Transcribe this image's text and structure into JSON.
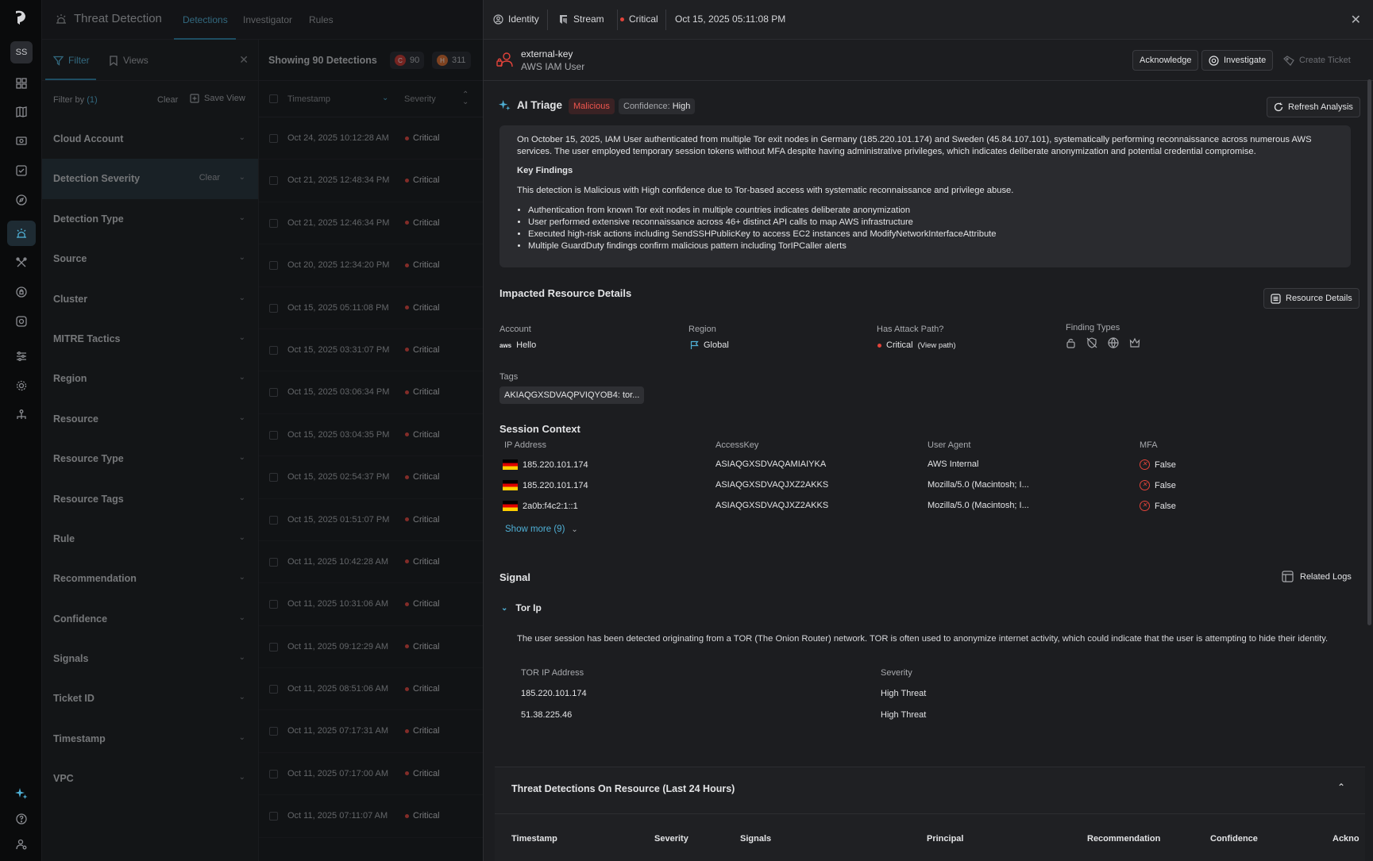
{
  "rail": {
    "avatar": "SS"
  },
  "header": {
    "title": "Threat Detection",
    "tabs": [
      "Detections",
      "Investigator",
      "Rules"
    ]
  },
  "filters": {
    "filter_tab": "Filter",
    "views_tab": "Views",
    "filter_by": "Filter by",
    "filter_count": "(1)",
    "clear": "Clear",
    "save_view": "Save View",
    "items": [
      "Cloud Account",
      "Detection Severity",
      "Detection Type",
      "Source",
      "Cluster",
      "MITRE Tactics",
      "Region",
      "Resource",
      "Resource Type",
      "Resource Tags",
      "Rule",
      "Recommendation",
      "Confidence",
      "Signals",
      "Ticket ID",
      "Timestamp",
      "VPC"
    ],
    "selected_clear": "Clear"
  },
  "list": {
    "showing": "Showing 90 Detections",
    "critical_badge": "C",
    "critical_count": "90",
    "high_badge": "H",
    "high_count": "311",
    "col_timestamp": "Timestamp",
    "col_severity": "Severity",
    "rows": [
      {
        "ts": "Oct 24, 2025 10:12:28 AM",
        "sev": "Critical"
      },
      {
        "ts": "Oct 21, 2025 12:48:34 PM",
        "sev": "Critical"
      },
      {
        "ts": "Oct 21, 2025 12:46:34 PM",
        "sev": "Critical"
      },
      {
        "ts": "Oct 20, 2025 12:34:20 PM",
        "sev": "Critical"
      },
      {
        "ts": "Oct 15, 2025 05:11:08 PM",
        "sev": "Critical"
      },
      {
        "ts": "Oct 15, 2025 03:31:07 PM",
        "sev": "Critical"
      },
      {
        "ts": "Oct 15, 2025 03:06:34 PM",
        "sev": "Critical"
      },
      {
        "ts": "Oct 15, 2025 03:04:35 PM",
        "sev": "Critical"
      },
      {
        "ts": "Oct 15, 2025 02:54:37 PM",
        "sev": "Critical"
      },
      {
        "ts": "Oct 15, 2025 01:51:07 PM",
        "sev": "Critical"
      },
      {
        "ts": "Oct 11, 2025 10:42:28 AM",
        "sev": "Critical"
      },
      {
        "ts": "Oct 11, 2025 10:31:06 AM",
        "sev": "Critical"
      },
      {
        "ts": "Oct 11, 2025 09:12:29 AM",
        "sev": "Critical"
      },
      {
        "ts": "Oct 11, 2025 08:51:06 AM",
        "sev": "Critical"
      },
      {
        "ts": "Oct 11, 2025 07:17:31 AM",
        "sev": "Critical"
      },
      {
        "ts": "Oct 11, 2025 07:17:00 AM",
        "sev": "Critical"
      },
      {
        "ts": "Oct 11, 2025 07:11:07 AM",
        "sev": "Critical"
      }
    ]
  },
  "panel": {
    "crumb_identity": "Identity",
    "crumb_stream": "Stream",
    "crumb_severity": "Critical",
    "crumb_time": "Oct 15, 2025 05:11:08 PM",
    "identity_name": "external-key",
    "identity_kind": "AWS IAM User",
    "btn_acknowledge": "Acknowledge",
    "btn_investigate": "Investigate",
    "btn_create_ticket": "Create Ticket",
    "triage": {
      "title": "AI Triage",
      "verdict": "Malicious",
      "confidence_label": "Confidence:",
      "confidence_value": "High",
      "refresh": "Refresh Analysis",
      "summary": "On October 15, 2025, IAM User authenticated from multiple Tor exit nodes in Germany (185.220.101.174) and Sweden (45.84.107.101), systematically performing reconnaissance across numerous AWS services. The user employed temporary session tokens without MFA despite having administrative privileges, which indicates deliberate anonymization and potential credential compromise.",
      "key_findings_title": "Key Findings",
      "statement": "This detection is Malicious with High confidence due to Tor-based access with systematic reconnaissance and privilege abuse.",
      "findings": [
        "Authentication from known Tor exit nodes in multiple countries indicates deliberate anonymization",
        "User performed extensive reconnaissance across 46+ distinct API calls to map AWS infrastructure",
        "Executed high-risk actions including SendSSHPublicKey to access EC2 instances and ModifyNetworkInterfaceAttribute",
        "Multiple GuardDuty findings confirm malicious pattern including TorIPCaller alerts"
      ]
    },
    "impacted": {
      "title": "Impacted Resource Details",
      "resource_details_btn": "Resource Details",
      "account_label": "Account",
      "account_value": "Hello",
      "aws_mark": "aws",
      "region_label": "Region",
      "region_value": "Global",
      "attack_label": "Has Attack Path?",
      "attack_value": "Critical",
      "view_path": "(View path)",
      "finding_types_label": "Finding Types",
      "tags_label": "Tags",
      "tag_value": "AKIAQGXSDVAQPVIQYOB4: tor..."
    },
    "session": {
      "title": "Session Context",
      "headers": [
        "IP Address",
        "AccessKey",
        "User Agent",
        "MFA"
      ],
      "rows": [
        {
          "ip": "185.220.101.174",
          "key": "ASIAQGXSDVAQAMIAIYKA",
          "agent": "AWS Internal",
          "mfa": "False"
        },
        {
          "ip": "185.220.101.174",
          "key": "ASIAQGXSDVAQJXZ2AKKS",
          "agent": "Mozilla/5.0 (Macintosh; I...",
          "mfa": "False"
        },
        {
          "ip": "2a0b:f4c2:1::1",
          "key": "ASIAQGXSDVAQJXZ2AKKS",
          "agent": "Mozilla/5.0 (Macintosh; I...",
          "mfa": "False"
        }
      ],
      "show_more": "Show more (9)"
    },
    "signal": {
      "title": "Signal",
      "related_logs": "Related Logs",
      "name": "Tor Ip",
      "description": "The user session has been detected originating from a TOR (The Onion Router) network. TOR is often used to anonymize internet activity, which could indicate that the user is attempting to hide their identity.",
      "col_ip": "TOR IP Address",
      "col_sev": "Severity",
      "rows": [
        {
          "ip": "185.220.101.174",
          "sev": "High Threat"
        },
        {
          "ip": "51.38.225.46",
          "sev": "High Threat"
        }
      ]
    },
    "threat": {
      "title": "Threat Detections On Resource (Last 24 Hours)",
      "headers": [
        "Timestamp",
        "Severity",
        "Signals",
        "Principal",
        "Recommendation",
        "Confidence",
        "Ackno"
      ]
    }
  }
}
